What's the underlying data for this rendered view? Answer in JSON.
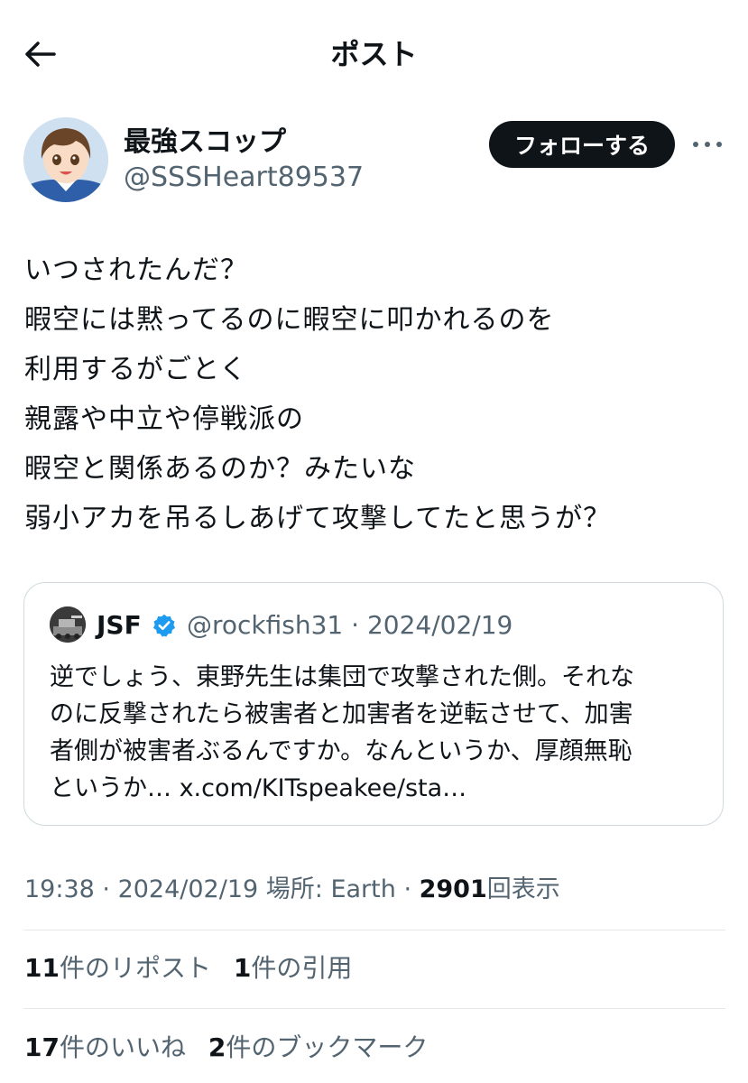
{
  "header": {
    "title": "ポスト",
    "back_icon": "arrow-left-icon"
  },
  "author": {
    "display_name": "最強スコップ",
    "handle": "@SSSHeart89537",
    "follow_label": "フォローする",
    "more_icon": "more-horizontal-icon"
  },
  "tweet": {
    "lines": [
      "いつされたんだ？",
      "暇空には黙ってるのに暇空に叩かれるのを",
      "利用するがごとく",
      "親露や中立や停戦派の",
      "暇空と関係あるのか？みたいな",
      "弱小アカを吊るしあげて攻撃してたと思うが？"
    ]
  },
  "quote": {
    "name": "JSF",
    "verified_icon": "verified-badge-icon",
    "meta": "@rockfish31 · 2024/02/19",
    "lines": [
      "逆でしょう、東野先生は集団で攻撃された側。それな",
      "のに反撃されたら被害者と加害者を逆転させて、加害",
      "者側が被害者ぶるんですか。なんというか、厚顔無恥",
      "というか… x.com/KITspeakee/sta…"
    ]
  },
  "meta": {
    "time": "19:38",
    "sep1": " · ",
    "date": "2024/02/19",
    "location": " 場所: Earth",
    "sep2": " · ",
    "views_count": "2901",
    "views_label": "回表示"
  },
  "stats": {
    "reposts_count": "11",
    "reposts_label": "件のリポスト",
    "quotes_count": "1",
    "quotes_label": "件の引用",
    "likes_count": "17",
    "likes_label": "件のいいね",
    "bookmarks_count": "2",
    "bookmarks_label": "件のブックマーク"
  },
  "colors": {
    "text_primary": "#0f1419",
    "text_secondary": "#536471",
    "verified_blue": "#1d9bf0",
    "border": "#cfd9de"
  }
}
